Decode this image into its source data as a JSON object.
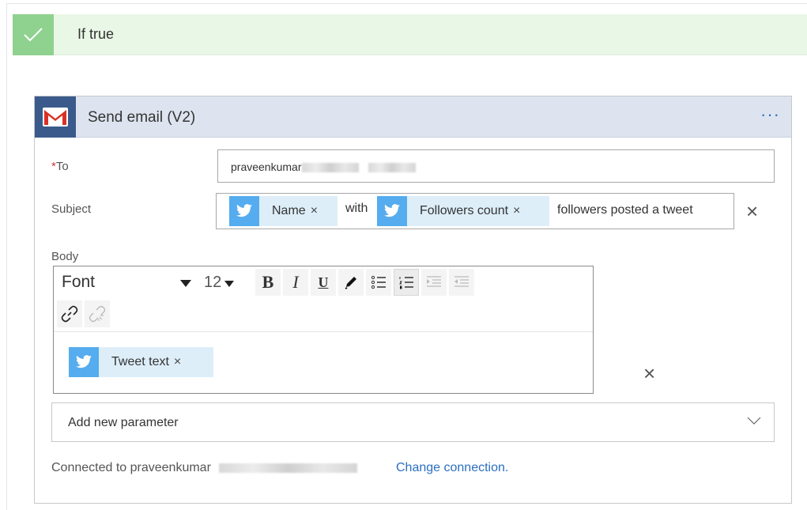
{
  "condition": {
    "label": "If true",
    "check_icon": "checkmark-icon"
  },
  "action": {
    "title": "Send email (V2)",
    "more_label": "···",
    "icon": "gmail-icon"
  },
  "fields": {
    "to": {
      "label": "To",
      "required_mark": "*",
      "value_prefix": "praveenkumar"
    },
    "subject": {
      "label": "Subject",
      "tokens": [
        {
          "name": "Name",
          "remove": "×"
        },
        {
          "name": "Followers count",
          "remove": "×"
        }
      ],
      "text_with": "with",
      "text_tail": "followers posted a tweet",
      "clear": "×"
    },
    "body": {
      "label": "Body",
      "font_label": "Font",
      "size_value": "12",
      "bold": "B",
      "italic": "I",
      "underline": "U",
      "token": {
        "name": "Tweet text",
        "remove": "×"
      },
      "clear": "×"
    }
  },
  "add_parameter": {
    "label": "Add new parameter"
  },
  "connection": {
    "prefix": "Connected to praveenkumar",
    "change_link": "Change connection."
  },
  "colors": {
    "twitter": "#55acee",
    "gmail_tile": "#3a5a8c",
    "condition_bg": "#e9f7e6",
    "link": "#2b6fc2"
  }
}
